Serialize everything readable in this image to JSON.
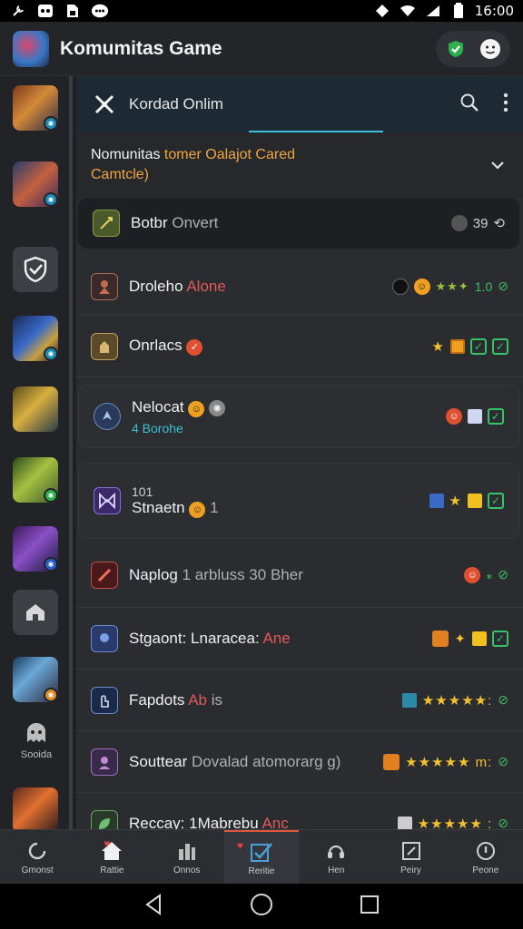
{
  "status": {
    "time": "16:00"
  },
  "appbar": {
    "title": "Komumitas Game"
  },
  "sidebar": {
    "label": "Sooida"
  },
  "tabbar": {
    "title": "Kordad Onlim"
  },
  "section": {
    "line1_white": "Nomunitas ",
    "line1_orange": "tomer Oalajot Cared",
    "line2": "Camtcle)"
  },
  "rows": [
    {
      "title": "Botbr ",
      "grey": "Onvert",
      "trail_text": "39"
    },
    {
      "title": "Droleho ",
      "red": "Alone",
      "trail_text": "1.0"
    },
    {
      "title": "Onrlacs"
    },
    {
      "title": "Nelocat",
      "subtitle": "4 Borohe"
    },
    {
      "pretitle": "101",
      "title": "Stnaetn",
      "after": "1"
    },
    {
      "title": "Naplog ",
      "grey": "1 arbluss 30 Bher"
    },
    {
      "title": "Stgaont: Lnaracea: ",
      "red": "Ane"
    },
    {
      "title": "Fapdots ",
      "red": "Ab",
      "grey2": " is",
      "stars": "★★★★★:"
    },
    {
      "title": "Souttear ",
      "grey": "Dovalad atomorarg g)",
      "stars": "★★★★★ m:"
    },
    {
      "title": "Reccay: 1Mabrebu ",
      "red": "Anc",
      "stars": "★★★★★ :"
    }
  ],
  "bottomnav": [
    {
      "label": "Gmonst"
    },
    {
      "label": "Rattie"
    },
    {
      "label": "Onnos"
    },
    {
      "label": "Reritie"
    },
    {
      "label": "Hen"
    },
    {
      "label": "Peiry"
    },
    {
      "label": "Peone"
    }
  ],
  "colors": {
    "accent": "#3cc0e0",
    "orange": "#f0a640",
    "active": "#e0563a",
    "green": "#35c46a"
  }
}
